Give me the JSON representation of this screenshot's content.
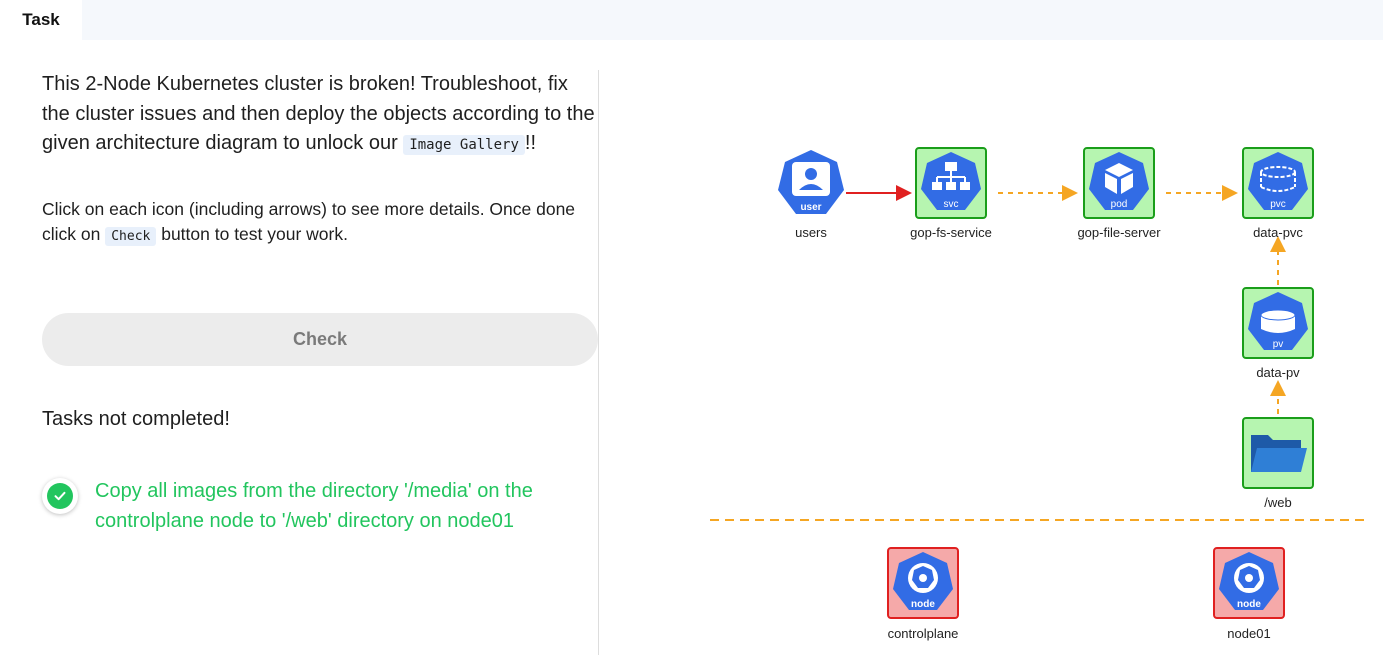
{
  "tabs": {
    "active": "Task"
  },
  "intro": {
    "text_before": "This 2-Node Kubernetes cluster is broken! Troubleshoot, fix the cluster issues and then deploy the objects according to the given architecture diagram to unlock our ",
    "code": "Image Gallery",
    "text_after": "!!"
  },
  "instructions": {
    "text_before": "Click on each icon (including arrows) to see more details. Once done click on ",
    "code": "Check",
    "text_after": " button to test your work."
  },
  "check_button": "Check",
  "status": "Tasks not completed!",
  "tasks": [
    {
      "text": "Copy all images from the directory '/media' on the controlplane node to '/web' directory on node01",
      "done": true
    }
  ],
  "diagram": {
    "nodes": {
      "users": {
        "label": "users",
        "badge": "user",
        "icon": "user-icon"
      },
      "service": {
        "label": "gop-fs-service",
        "badge": "svc",
        "icon": "service-icon"
      },
      "pod": {
        "label": "gop-file-server",
        "badge": "pod",
        "icon": "pod-icon"
      },
      "pvc": {
        "label": "data-pvc",
        "badge": "pvc",
        "icon": "pvc-icon"
      },
      "pv": {
        "label": "data-pv",
        "badge": "pv",
        "icon": "pv-icon"
      },
      "web": {
        "label": "/web",
        "icon": "folder-icon"
      },
      "controlplane": {
        "label": "controlplane",
        "badge": "node",
        "icon": "kubernetes-node-icon"
      },
      "node01": {
        "label": "node01",
        "badge": "node",
        "icon": "kubernetes-node-icon"
      }
    }
  },
  "colors": {
    "k8s_blue": "#326ce5",
    "green_box": "#b6f5b0",
    "green_border": "#1a9e1a",
    "red_box": "#f5a9a9",
    "red_border": "#e02020",
    "arrow_orange": "#f5a623",
    "arrow_red": "#e02020",
    "task_green": "#22c55e"
  }
}
